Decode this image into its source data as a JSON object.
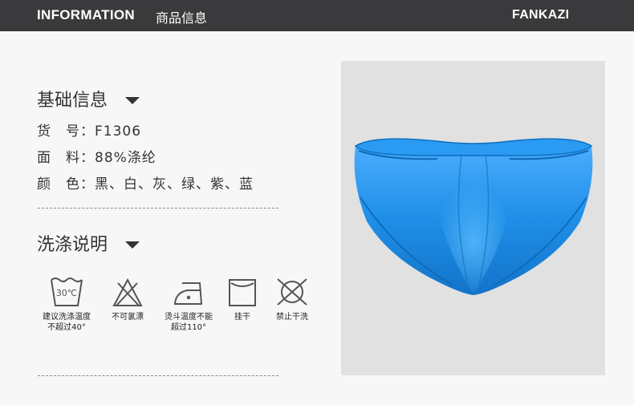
{
  "header": {
    "info_label": "INFORMATION",
    "info_cn": "商品信息",
    "brand": "FANKAZI"
  },
  "basic": {
    "title": "基础信息",
    "rows": [
      {
        "label": "货　号：",
        "value": "F1306"
      },
      {
        "label": "面　料：",
        "value": "88%涤纶"
      },
      {
        "label": "颜　色：",
        "value": "黑、白、灰、绿、紫、蓝"
      }
    ]
  },
  "wash": {
    "title": "洗涤说明",
    "tub_temp": "30℃",
    "items": [
      {
        "icon": "wash-tub-icon",
        "line1": "建议洗涤温度",
        "line2": "不超过40°"
      },
      {
        "icon": "no-bleach-icon",
        "line1": "不可氯漂",
        "line2": ""
      },
      {
        "icon": "iron-icon",
        "line1": "烫斗温度不能",
        "line2": "超过110°"
      },
      {
        "icon": "hang-dry-icon",
        "line1": "挂干",
        "line2": ""
      },
      {
        "icon": "no-tumble-dry-icon",
        "line1": "禁止干洗",
        "line2": ""
      }
    ]
  },
  "colors": {
    "topbar": "#3a3a3c",
    "product": "#1f8fe8",
    "photo_bg": "#e1e1e1"
  }
}
